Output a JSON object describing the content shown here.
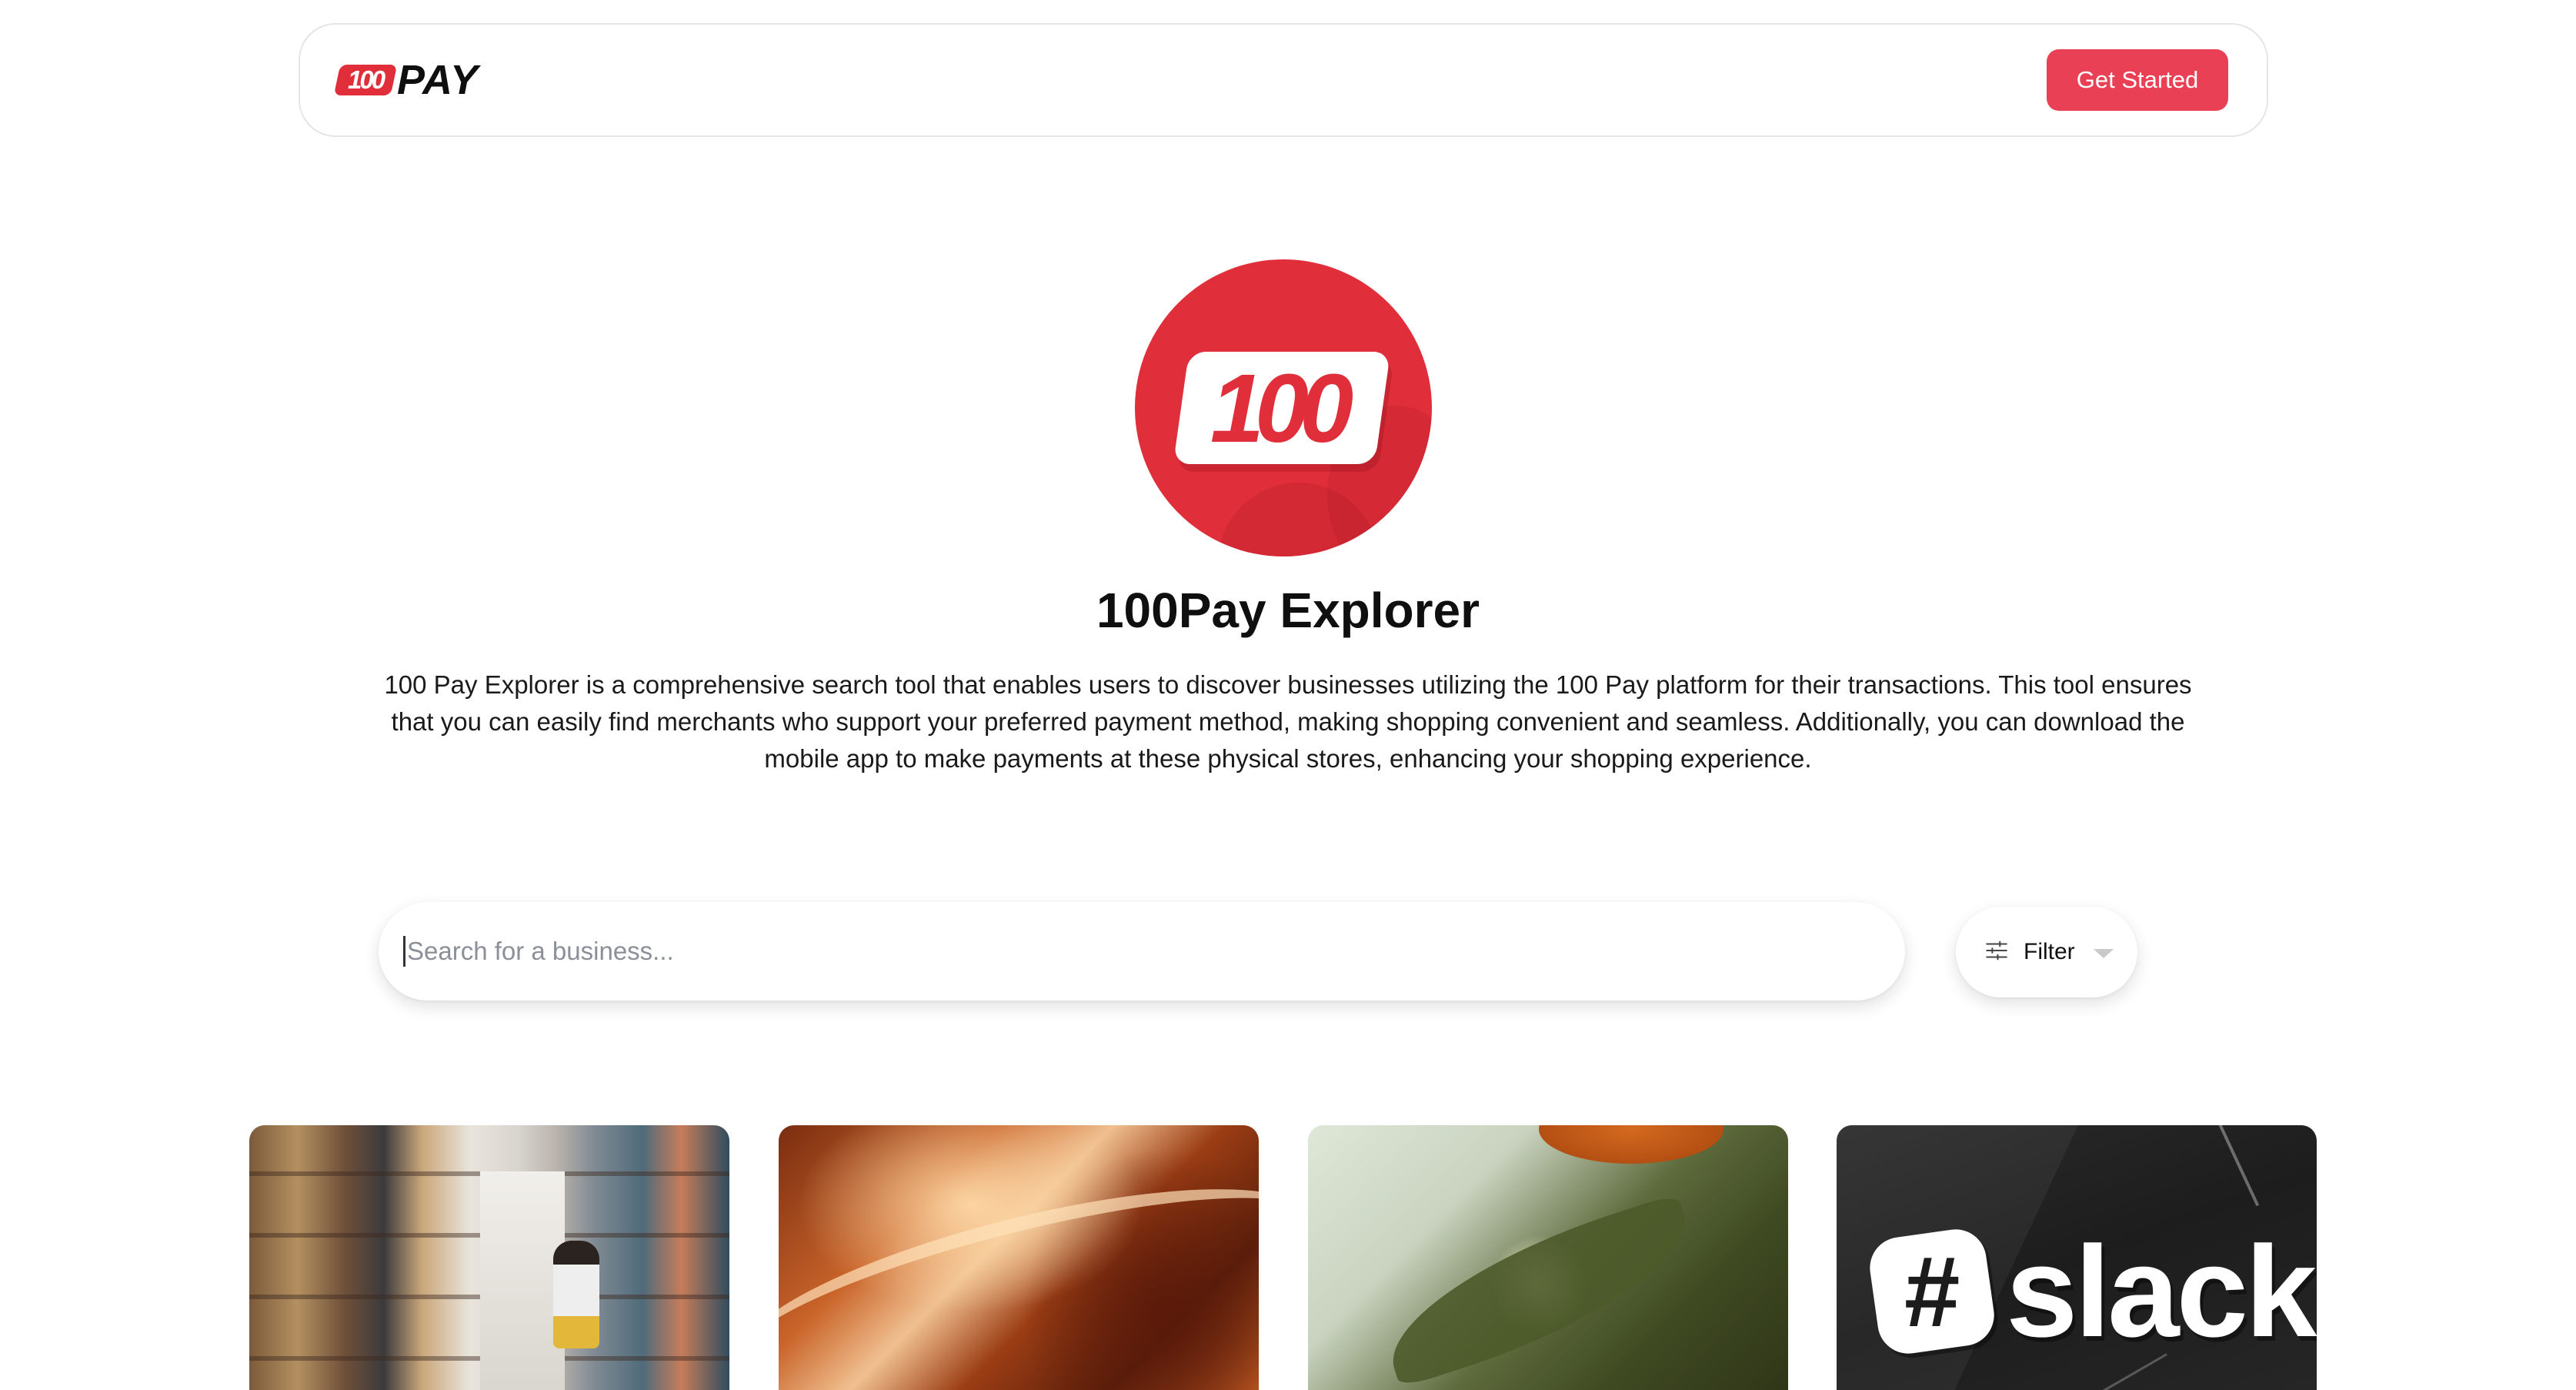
{
  "header": {
    "brand_badge": "100",
    "brand_word": "PAY",
    "cta_label": "Get Started"
  },
  "hero": {
    "logo_text": "100",
    "title": "100Pay Explorer",
    "description": "100 Pay Explorer is a comprehensive search tool that enables users to discover businesses utilizing the 100 Pay platform for their transactions. This tool ensures that you can easily find merchants who support your preferred payment method, making shopping convenient and seamless. Additionally, you can download the mobile app to make payments at these physical stores, enhancing your shopping experience."
  },
  "search": {
    "placeholder": "Search for a business...",
    "value": ""
  },
  "filter": {
    "label": "Filter",
    "icon": "sliders-icon"
  },
  "cards": [
    {
      "image": "library-bookshelves"
    },
    {
      "image": "abstract-orange-waves"
    },
    {
      "image": "leaves-and-flower"
    },
    {
      "image": "slack-logo",
      "logo_text": "slack"
    }
  ],
  "colors": {
    "accent": "#ea4055",
    "brand_red": "#e02f3a"
  }
}
